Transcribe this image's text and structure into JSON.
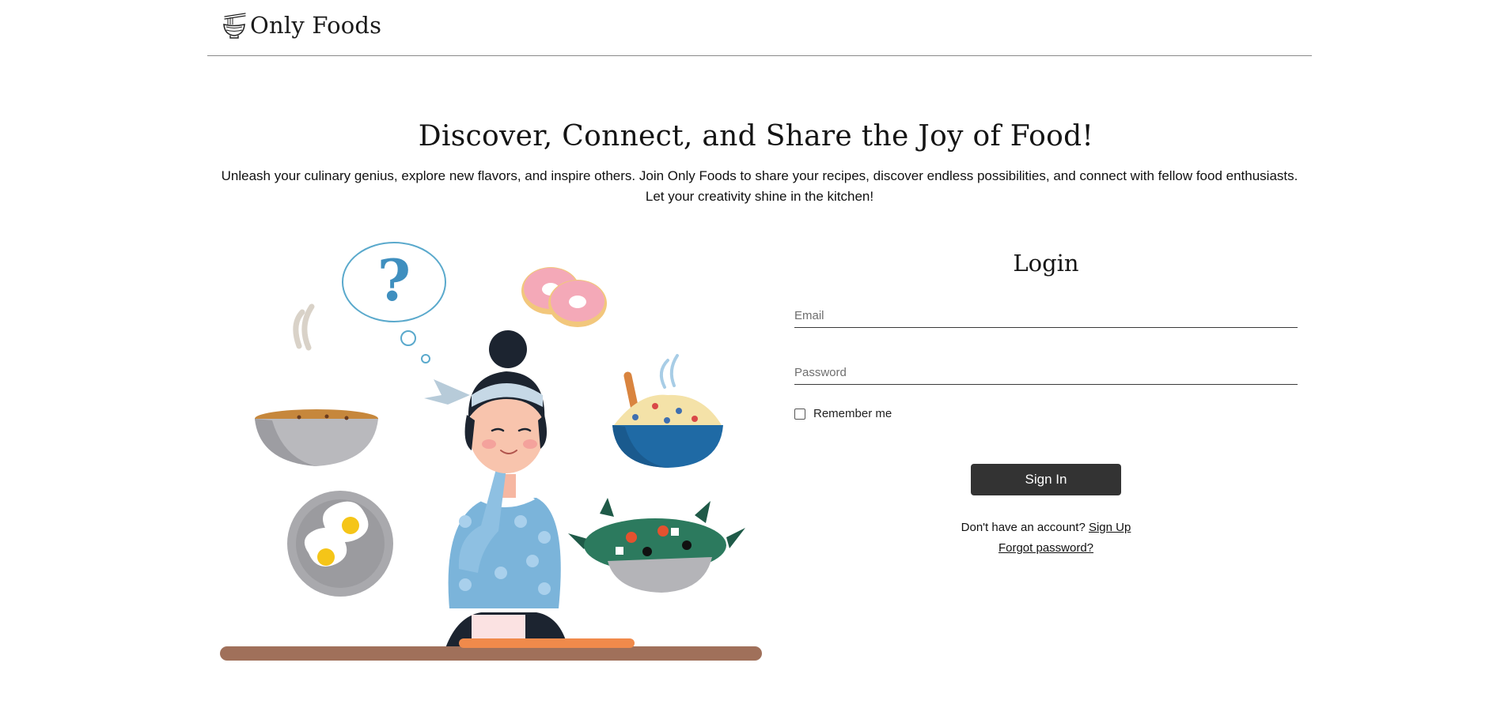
{
  "header": {
    "brand": "Only Foods",
    "logo_icon": "noodle-bowl-icon"
  },
  "hero": {
    "title": "Discover, Connect, and Share the Joy of Food!",
    "subtitle_line1": "Unleash your culinary genius, explore new flavors, and inspire others. Join Only Foods to share your recipes, discover endless possibilities, and connect with fellow food enthusiasts.",
    "subtitle_line2": "Let your creativity shine in the kitchen!"
  },
  "illustration": {
    "thought_symbol": "?",
    "colors": {
      "blue": "#3f8fbf",
      "table": "#a0705a",
      "board": "#f08a4b",
      "donut": "#f4a9b8",
      "hair": "#1c2430"
    }
  },
  "login": {
    "title": "Login",
    "email_placeholder": "Email",
    "password_placeholder": "Password",
    "remember_label": "Remember me",
    "signin_label": "Sign In",
    "no_account_text": "Don't have an account?",
    "signup_link": "Sign Up",
    "forgot_link": "Forgot password?"
  },
  "colors": {
    "button_bg": "#333333",
    "divider": "#8a8a8a"
  }
}
